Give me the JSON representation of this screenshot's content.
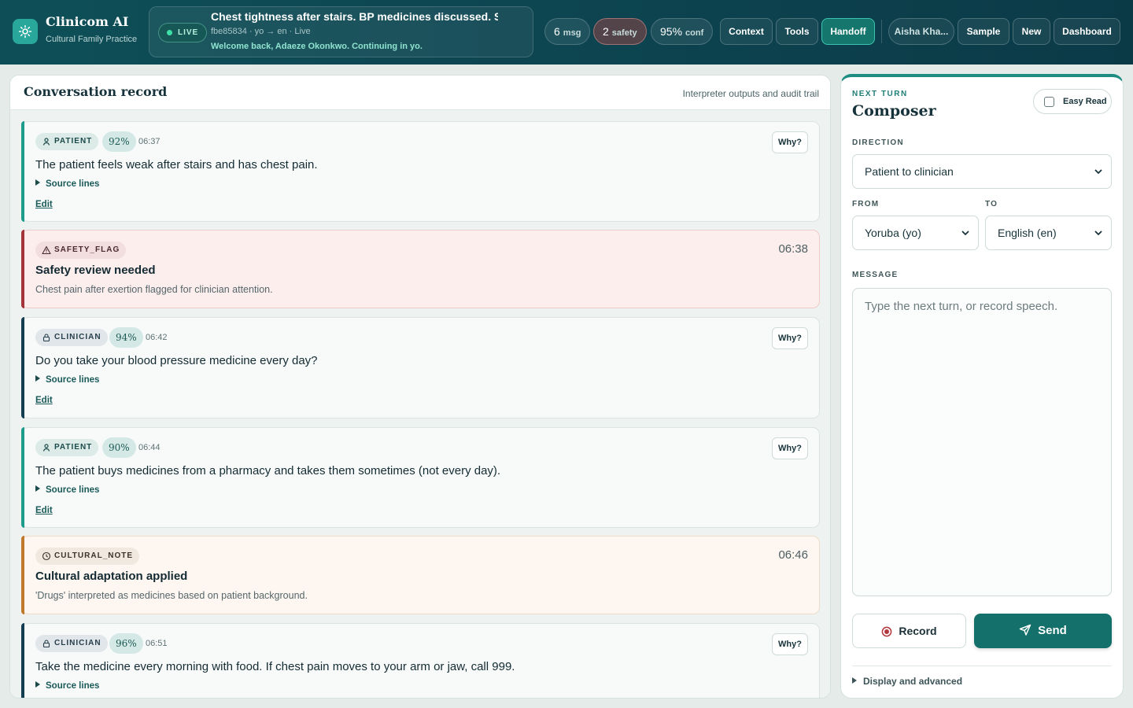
{
  "app": {
    "name": "Clinicom AI",
    "subtitle": "Cultural Family Practice",
    "brand_color": "#0e4f57",
    "accent_color": "#13706a"
  },
  "session": {
    "status": "LIVE",
    "title": "Chest tightness after stairs. BP medicines discussed. S...",
    "meta": "fbe85834 · yo → en · Live",
    "welcome": "Welcome back, Adaeze Okonkwo. Continuing in yo."
  },
  "stats": [
    {
      "value": "6",
      "unit": "msg"
    },
    {
      "value": "2",
      "unit": "safety"
    },
    {
      "value": "95%",
      "unit": "conf"
    }
  ],
  "header_buttons": {
    "context": "Context",
    "tools": "Tools",
    "handoff": "Handoff",
    "user": "Aisha Kha...",
    "sample": "Sample",
    "new": "New",
    "dashboard": "Dashboard"
  },
  "conversation": {
    "title": "Conversation record",
    "subtitle": "Interpreter outputs and audit trail",
    "source_label": "Source lines",
    "edit_label": "Edit",
    "why_label": "Why?",
    "messages": [
      {
        "role": "PATIENT",
        "confidence": "92%",
        "time": "06:37",
        "text": "The patient feels weak after stairs and has chest pain."
      },
      {
        "role": "SAFETY_FLAG",
        "time": "06:38",
        "title": "Safety review needed",
        "detail": "Chest pain after exertion flagged for clinician attention."
      },
      {
        "role": "CLINICIAN",
        "confidence": "94%",
        "time": "06:42",
        "text": "Do you take your blood pressure medicine every day?"
      },
      {
        "role": "PATIENT",
        "confidence": "90%",
        "time": "06:44",
        "text": "The patient buys medicines from a pharmacy and takes them sometimes (not every day)."
      },
      {
        "role": "CULTURAL_NOTE",
        "time": "06:46",
        "title": "Cultural adaptation applied",
        "detail": "'Drugs' interpreted as medicines based on patient background."
      },
      {
        "role": "CLINICIAN",
        "confidence": "96%",
        "time": "06:51",
        "text": "Take the medicine every morning with food. If chest pain moves to your arm or jaw, call 999."
      }
    ]
  },
  "composer": {
    "eyebrow": "NEXT TURN",
    "title": "Composer",
    "easy_read": "Easy Read",
    "direction_label": "DIRECTION",
    "direction_value": "Patient to clinician",
    "from_label": "FROM",
    "from_value": "Yoruba (yo)",
    "to_label": "TO",
    "to_value": "English (en)",
    "message_label": "MESSAGE",
    "message_placeholder": "Type the next turn, or record speech.",
    "record": "Record",
    "send": "Send",
    "advanced": "Display and advanced"
  }
}
